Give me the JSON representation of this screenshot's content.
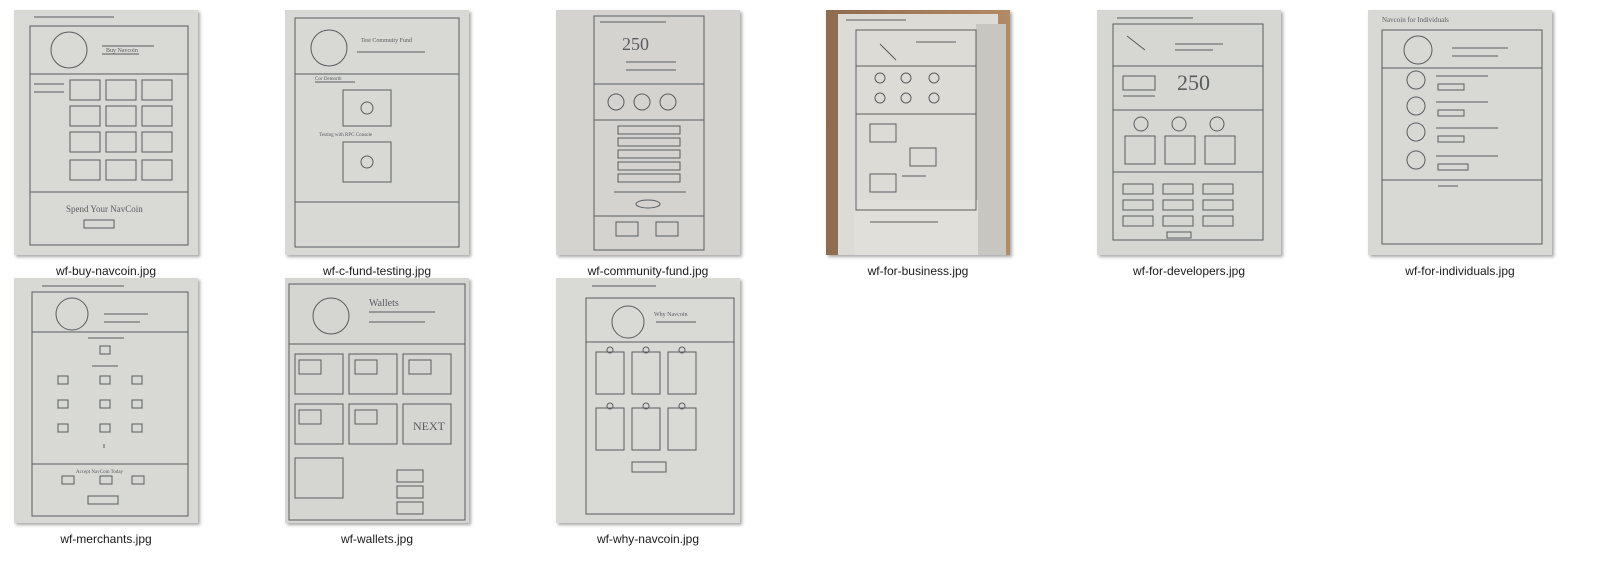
{
  "files": [
    {
      "name": "wf-buy-navcoin.jpg",
      "layout": "buy"
    },
    {
      "name": "wf-c-fund-testing.jpg",
      "layout": "cfund"
    },
    {
      "name": "wf-community-fund.jpg",
      "layout": "community"
    },
    {
      "name": "wf-for-business.jpg",
      "layout": "business"
    },
    {
      "name": "wf-for-developers.jpg",
      "layout": "developers"
    },
    {
      "name": "wf-for-individuals.jpg",
      "layout": "individuals"
    },
    {
      "name": "wf-merchants.jpg",
      "layout": "merchants"
    },
    {
      "name": "wf-wallets.jpg",
      "layout": "wallets"
    },
    {
      "name": "wf-why-navcoin.jpg",
      "layout": "why"
    }
  ],
  "sketch_text": {
    "buy_heading": "Buy Navcoin",
    "buy_footer": "Spend Your NavCoin",
    "cfund_heading": "Test Commuity Fund",
    "cfund_section1": "Cor Demorth",
    "cfund_section2": "Testing with RPC Console",
    "big_number": "250",
    "wallets_heading": "Wallets",
    "why_heading": "Why Navcoin",
    "individuals_heading": "Navcoin for Individuals",
    "next_label": "NEXT",
    "merchants_footer": "Accept NavCoin Today"
  },
  "colors": {
    "paper": "#dadad6",
    "paper_warm": "#d6d3cc",
    "paper_cool": "#d3d4d2",
    "ink": "#55575a",
    "caption": "#1a1a1a",
    "wood": "#a57c5a"
  }
}
